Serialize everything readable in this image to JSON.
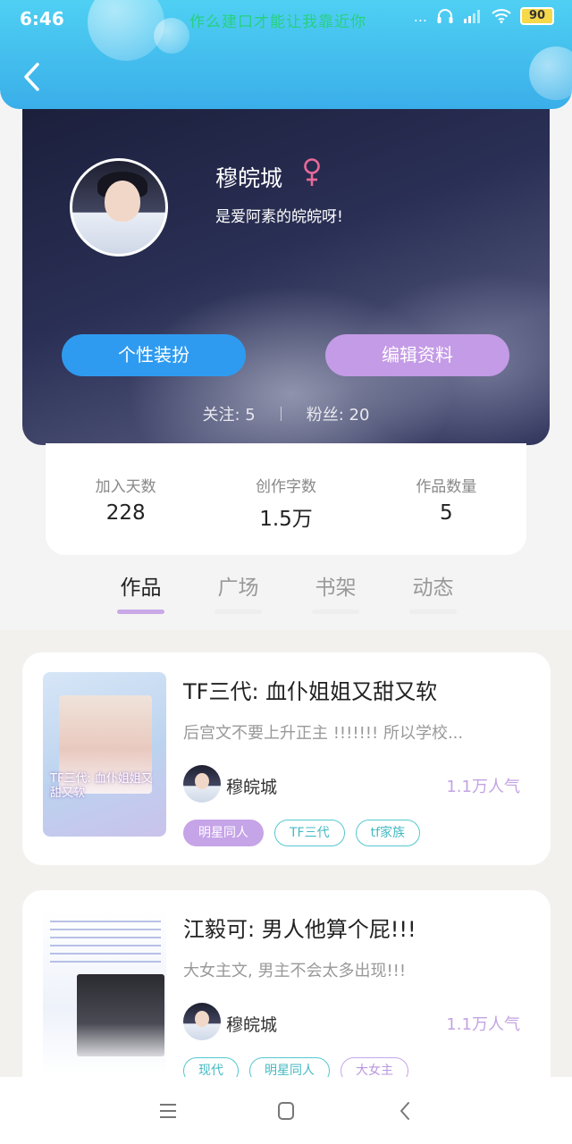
{
  "status_bar": {
    "time": "6:46",
    "notification": "作么建口才能让我靠近你",
    "signal_dots": "...",
    "battery": "90"
  },
  "profile": {
    "name": "穆皖城",
    "gender_symbol": "♀",
    "bio": "是爱阿素的皖皖呀!",
    "dressup_label": "个性装扮",
    "edit_label": "编辑资料",
    "following": "关注: 5",
    "followers": "粉丝: 20"
  },
  "stats": [
    {
      "label": "加入天数",
      "value": "228"
    },
    {
      "label": "创作字数",
      "value": "1.5万"
    },
    {
      "label": "作品数量",
      "value": "5"
    }
  ],
  "tabs": [
    {
      "label": "作品",
      "active": true
    },
    {
      "label": "广场",
      "active": false
    },
    {
      "label": "书架",
      "active": false
    },
    {
      "label": "动态",
      "active": false
    }
  ],
  "works": [
    {
      "title": "TF三代: 血仆姐姐又甜又软",
      "description": "后宫文不要上升正主 !!!!!!!  所以学校...",
      "cover_text": "TF三代: 血仆姐姐又甜又软",
      "author": "穆皖城",
      "popularity": "1.1万人气",
      "tags": [
        "明星同人",
        "TF三代",
        "tf家族"
      ]
    },
    {
      "title": "江毅可: 男人他算个屁!!!",
      "description": "大女主文, 男主不会太多出现!!!",
      "author": "穆皖城",
      "popularity": "1.1万人气",
      "tags": [
        "现代",
        "明星同人",
        "大女主"
      ]
    }
  ],
  "colors": {
    "topbar": "#3aaee9",
    "dressup_button": "#2f9bf0",
    "edit_button": "#c49be6",
    "tab_indicator": "#c9a9e6",
    "popularity": "#c3a4e2",
    "tag_teal": "#55c7cf"
  }
}
